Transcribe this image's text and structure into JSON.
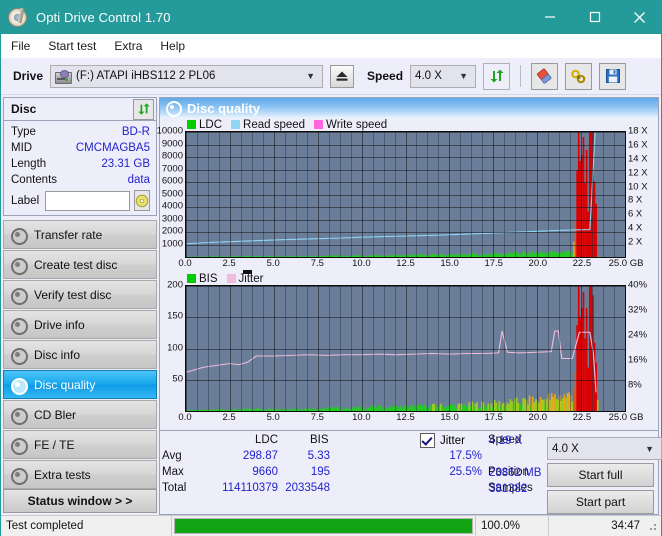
{
  "window": {
    "title": "Opti Drive Control 1.70",
    "icon": "disc-icon",
    "minimize": "minimize-icon",
    "maximize": "maximize-icon",
    "close": "close-icon"
  },
  "menu": [
    "File",
    "Start test",
    "Extra",
    "Help"
  ],
  "toolbar": {
    "drive_label": "Drive",
    "drive_value": "(F:)  ATAPI iHBS112  2 PL06",
    "eject": "eject-icon",
    "speed_label": "Speed",
    "speed_value": "4.0 X",
    "refresh": "refresh-icon",
    "erase": "eraser-icon",
    "tools": "tools-icon",
    "save": "save-icon"
  },
  "disc_panel": {
    "title": "Disc",
    "refresh": "refresh-icon",
    "rows": [
      {
        "key": "Type",
        "value": "BD-R"
      },
      {
        "key": "MID",
        "value": "CMCMAGBA5"
      },
      {
        "key": "Length",
        "value": "23.31 GB"
      },
      {
        "key": "Contents",
        "value": "data"
      }
    ],
    "label_key": "Label",
    "label_value": "",
    "label_placeholder": "",
    "label_button": "disc-label-icon"
  },
  "nav": [
    {
      "label": "Transfer rate",
      "active": false
    },
    {
      "label": "Create test disc",
      "active": false
    },
    {
      "label": "Verify test disc",
      "active": false
    },
    {
      "label": "Drive info",
      "active": false
    },
    {
      "label": "Disc info",
      "active": false
    },
    {
      "label": "Disc quality",
      "active": true
    },
    {
      "label": "CD Bler",
      "active": false
    },
    {
      "label": "FE / TE",
      "active": false
    },
    {
      "label": "Extra tests",
      "active": false
    }
  ],
  "status_window_button": "Status window > >",
  "panel": {
    "title": "Disc quality",
    "icon": "disc-quality-icon"
  },
  "stats": {
    "col_ldc": "LDC",
    "col_bis": "BIS",
    "row_avg": "Avg",
    "row_max": "Max",
    "row_total": "Total",
    "avg_ldc": "298.87",
    "avg_bis": "5.33",
    "max_ldc": "9660",
    "max_bis": "195",
    "total_ldc": "114110379",
    "total_bis": "2033548",
    "jitter_label": "Jitter",
    "jitter_checked": true,
    "jitter_avg": "17.5%",
    "jitter_max": "25.5%",
    "speed_label": "Speed",
    "speed_value": "4.19 X",
    "position_label": "Position",
    "position_value": "23862 MB",
    "samples_label": "Samples",
    "samples_value": "381382",
    "speed_select": "4.0 X",
    "start_full": "Start full",
    "start_part": "Start part"
  },
  "statusbar": {
    "message": "Test completed",
    "percent_text": "100.0%",
    "percent_value": 100,
    "elapsed": "34:47"
  },
  "colors": {
    "titlebar": "#239a9a",
    "plot_bg": "#6b7e99",
    "ldc": "#00cc00",
    "read_speed": "#8fd8f5",
    "write_speed": "#ff66dd",
    "bis": "#00cc00",
    "jitter": "#f0bcdc",
    "accent_value": "#2222cc",
    "progress": "#13a413"
  },
  "chart_data": [
    {
      "type": "area",
      "name": "ldc-read-speed-chart",
      "title": "",
      "xlabel": "GB",
      "ylabel": "",
      "xlim": [
        0,
        25
      ],
      "ylim": [
        0,
        10000
      ],
      "y2lim": [
        0,
        18
      ],
      "grid": true,
      "legend_position": "top-left",
      "legend": [
        "LDC",
        "Read speed",
        "Write speed"
      ],
      "xticks": [
        "0.0",
        "2.5",
        "5.0",
        "7.5",
        "10.0",
        "12.5",
        "15.0",
        "17.5",
        "20.0",
        "22.5",
        "25.0 GB"
      ],
      "yticks": [
        "10000",
        "9000",
        "8000",
        "7000",
        "6000",
        "5000",
        "4000",
        "3000",
        "2000",
        "1000"
      ],
      "y2ticks": [
        "18 X",
        "16 X",
        "14 X",
        "12 X",
        "10 X",
        "8 X",
        "6 X",
        "4 X",
        "2 X"
      ],
      "series": [
        {
          "name": "LDC",
          "color": "#00cc00",
          "type": "area",
          "x": [
            0.0,
            1.0,
            2.0,
            3.0,
            4.0,
            5.0,
            6.0,
            7.0,
            8.0,
            9.0,
            10.0,
            11.0,
            12.0,
            13.0,
            14.0,
            15.0,
            16.0,
            17.0,
            18.0,
            19.0,
            20.0,
            21.0,
            21.6,
            22.0,
            22.3,
            22.5,
            22.7,
            22.9,
            23.1,
            23.3,
            23.4
          ],
          "values": [
            30,
            40,
            60,
            70,
            80,
            90,
            100,
            110,
            120,
            130,
            140,
            150,
            170,
            190,
            210,
            240,
            270,
            300,
            340,
            380,
            430,
            480,
            520,
            600,
            9200,
            9660,
            9500,
            9400,
            9300,
            9200,
            200
          ]
        },
        {
          "name": "Read speed",
          "color": "#8fd8f5",
          "type": "line",
          "x": [
            0.0,
            1.0,
            2.5,
            4.0,
            5.5,
            7.0,
            8.5,
            10.0,
            11.5,
            13.0,
            14.5,
            16.0,
            17.5,
            19.0,
            20.0,
            21.0,
            22.0,
            23.0,
            23.3
          ],
          "values": [
            1.9,
            2.05,
            2.2,
            2.35,
            2.5,
            2.6,
            2.7,
            2.85,
            2.95,
            3.05,
            3.15,
            3.3,
            3.45,
            3.6,
            3.7,
            3.8,
            3.9,
            3.95,
            18.0
          ]
        },
        {
          "name": "Write speed",
          "color": "#ff66dd",
          "type": "line",
          "x": [],
          "values": []
        }
      ]
    },
    {
      "type": "area",
      "name": "bis-jitter-chart",
      "title": "",
      "xlabel": "GB",
      "ylabel": "",
      "xlim": [
        0,
        25
      ],
      "ylim": [
        0,
        200
      ],
      "y2lim": [
        0,
        40
      ],
      "grid": true,
      "legend_position": "top-left",
      "legend": [
        "BIS",
        "Jitter"
      ],
      "xticks": [
        "0.0",
        "2.5",
        "5.0",
        "7.5",
        "10.0",
        "12.5",
        "15.0",
        "17.5",
        "20.0",
        "22.5",
        "25.0 GB"
      ],
      "yticks": [
        "200",
        "150",
        "100",
        "50"
      ],
      "y2ticks": [
        "40%",
        "32%",
        "24%",
        "16%",
        "8%"
      ],
      "series": [
        {
          "name": "BIS",
          "color": "#00cc00",
          "type": "area",
          "x": [
            0.0,
            1.0,
            2.0,
            3.0,
            4.0,
            5.0,
            6.0,
            7.0,
            8.0,
            9.0,
            10.0,
            11.0,
            12.0,
            13.0,
            14.0,
            15.0,
            16.0,
            17.0,
            18.0,
            19.0,
            20.0,
            20.5,
            21.0,
            21.5,
            22.0,
            22.3,
            22.5,
            22.7,
            22.9,
            23.1,
            23.3,
            23.4
          ],
          "values": [
            2,
            2,
            3,
            3,
            4,
            4,
            5,
            5,
            6,
            6,
            7,
            8,
            8,
            9,
            10,
            11,
            12,
            14,
            16,
            19,
            22,
            25,
            28,
            30,
            33,
            175,
            195,
            185,
            178,
            172,
            165,
            28
          ]
        },
        {
          "name": "Jitter",
          "color": "#f0bcdc",
          "type": "line",
          "x": [
            0.0,
            0.5,
            1.0,
            1.5,
            2.0,
            2.5,
            3.0,
            3.5,
            4.0,
            5.0,
            6.0,
            7.0,
            8.0,
            9.0,
            10.0,
            11.0,
            12.0,
            13.0,
            14.0,
            15.0,
            16.0,
            17.0,
            17.8,
            18.0,
            18.3,
            19.0,
            20.0,
            20.8,
            21.0,
            21.2,
            21.4,
            22.0,
            22.4,
            22.6,
            23.0,
            23.2,
            23.35
          ],
          "values": [
            62,
            66,
            70,
            72,
            74,
            76,
            74,
            78,
            88,
            88,
            89,
            90,
            89,
            90,
            90,
            91,
            90,
            91,
            92,
            91,
            92,
            92,
            93,
            128,
            94,
            93,
            94,
            95,
            128,
            128,
            84,
            84,
            126,
            126,
            126,
            92,
            30
          ]
        }
      ]
    }
  ]
}
